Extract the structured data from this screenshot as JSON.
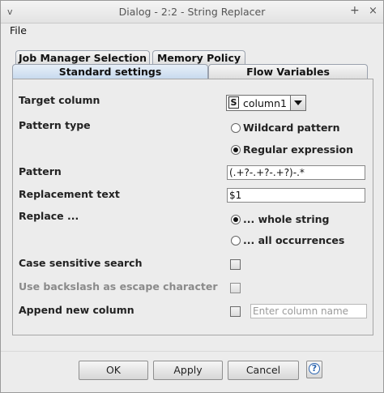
{
  "window": {
    "title": "Dialog - 2:2 - String Replacer",
    "minimize_glyph": "v",
    "maximize_glyph": "+",
    "close_glyph": "×"
  },
  "menu": {
    "file": "File"
  },
  "tabs": {
    "job_manager": "Job Manager Selection",
    "memory_policy": "Memory Policy",
    "standard_settings": "Standard settings",
    "flow_variables": "Flow Variables",
    "selected": "Standard settings"
  },
  "form": {
    "target_column_label": "Target column",
    "target_column_type_badge": "S",
    "target_column_value": "column1",
    "pattern_type_label": "Pattern type",
    "pattern_type_options": [
      "Wildcard pattern",
      "Regular expression"
    ],
    "pattern_type_selected": "Regular expression",
    "pattern_label": "Pattern",
    "pattern_value": "(.+?-.+?-.+?)-.*",
    "replacement_label": "Replacement text",
    "replacement_value": "$1",
    "replace_label": "Replace ...",
    "replace_options": [
      "... whole string",
      "... all occurrences"
    ],
    "replace_selected": "... whole string",
    "case_sensitive_label": "Case sensitive search",
    "case_sensitive_checked": false,
    "backslash_label": "Use backslash as escape character",
    "backslash_checked": false,
    "backslash_enabled": false,
    "append_label": "Append new column",
    "append_checked": false,
    "new_column_placeholder": "Enter column name"
  },
  "buttons": {
    "ok": "OK",
    "apply": "Apply",
    "cancel": "Cancel",
    "help_glyph": "?"
  }
}
